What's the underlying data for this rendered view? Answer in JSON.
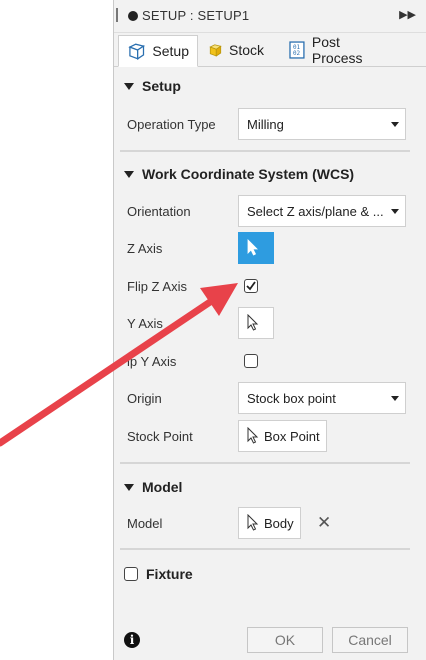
{
  "window": {
    "title": "SETUP : SETUP1"
  },
  "tabs": [
    {
      "label": "Setup",
      "icon": "setup-icon"
    },
    {
      "label": "Stock",
      "icon": "stock-icon"
    },
    {
      "label": "Post Process",
      "icon": "post-process-icon"
    }
  ],
  "setup": {
    "heading": "Setup",
    "operation_type_label": "Operation Type",
    "operation_type_value": "Milling"
  },
  "wcs": {
    "heading": "Work Coordinate System (WCS)",
    "orientation_label": "Orientation",
    "orientation_value": "Select Z axis/plane & ...",
    "z_axis_label": "Z Axis",
    "flip_z_label": "Flip Z Axis",
    "flip_z_checked": true,
    "y_axis_label": "Y Axis",
    "flip_y_label": "ip Y Axis",
    "flip_y_checked": false,
    "origin_label": "Origin",
    "origin_value": "Stock box point",
    "stock_point_label": "Stock Point",
    "stock_point_value": "Box Point"
  },
  "model": {
    "heading": "Model",
    "model_label": "Model",
    "model_value": "Body"
  },
  "fixture": {
    "heading": "Fixture",
    "checked": false
  },
  "footer": {
    "ok_label": "OK",
    "cancel_label": "Cancel"
  },
  "colors": {
    "accent": "#2e9ce0",
    "annotation_arrow": "#e8424a"
  }
}
